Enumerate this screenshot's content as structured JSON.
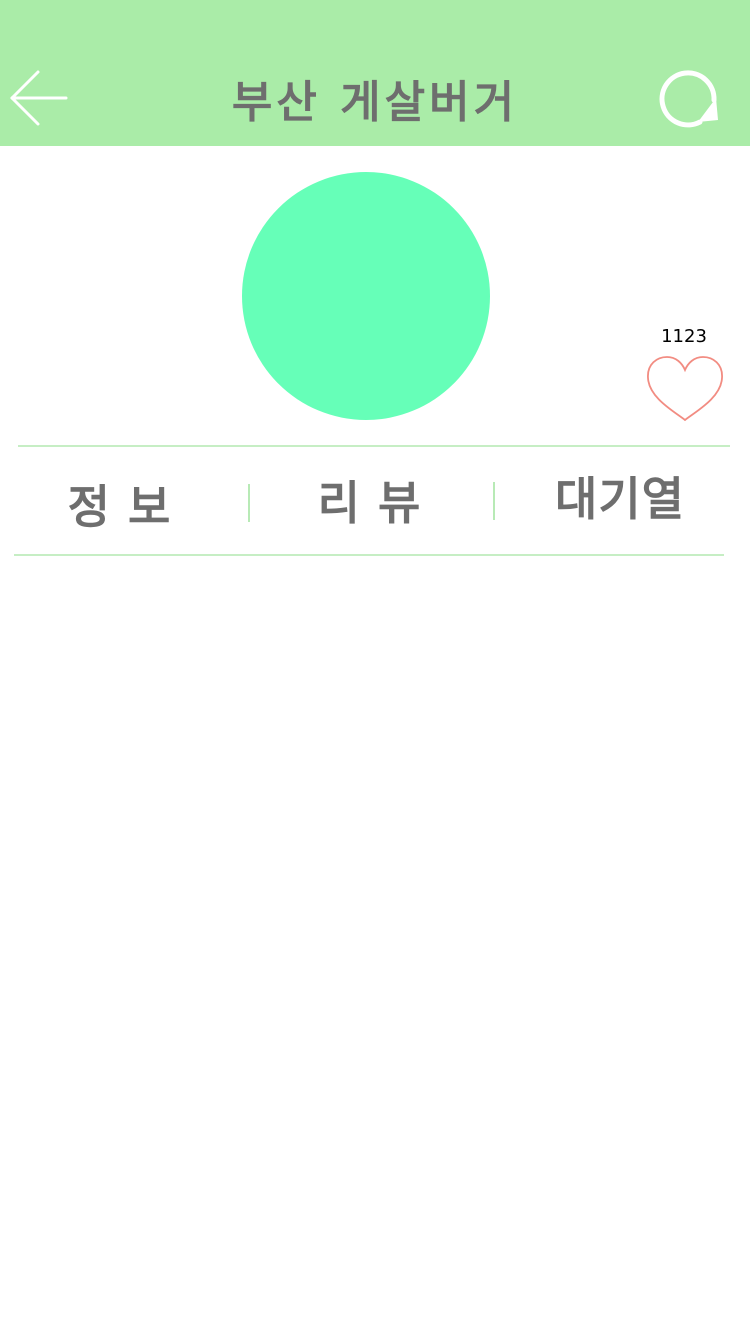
{
  "header": {
    "title": "부산 게살버거",
    "background_color": "#aaeca8",
    "back_icon": "arrow-left-icon",
    "refresh_icon": "refresh-icon"
  },
  "profile": {
    "avatar_color": "#66ffb8",
    "like_count": "1123",
    "like_icon": "heart-outline-icon",
    "like_color": "#f28c82"
  },
  "tabs": [
    {
      "label": "정보"
    },
    {
      "label": "리뷰"
    },
    {
      "label": "대기열"
    }
  ]
}
